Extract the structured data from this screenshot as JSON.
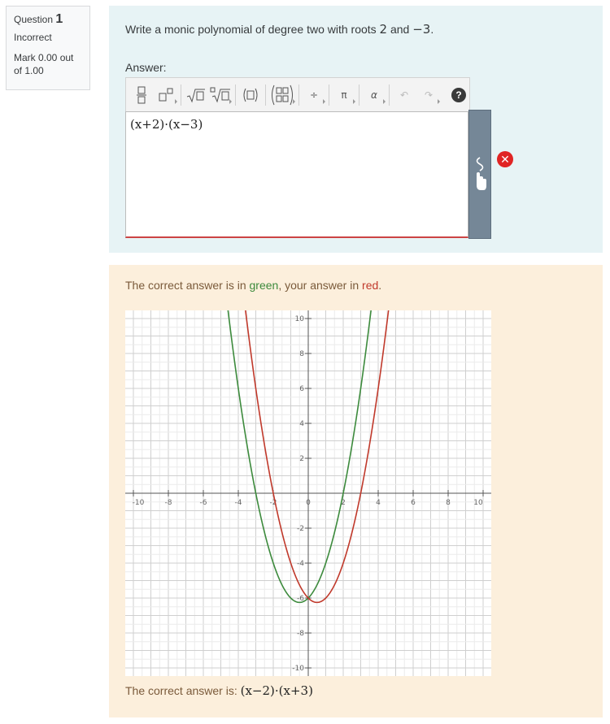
{
  "info": {
    "question_label": "Question",
    "question_number": "1",
    "state": "Incorrect",
    "mark": "Mark 0.00 out of 1.00"
  },
  "question": {
    "text_before": "Write a monic polynomial of degree two with roots ",
    "root1": "2",
    "text_and": " and ",
    "root2": "−3",
    "text_after": "."
  },
  "answer_label": "Answer:",
  "toolbar": {
    "icons": [
      "fraction-icon",
      "superscript-icon",
      "sqrt-icon",
      "nthroot-icon",
      "parentheses-icon",
      "matrix-icon",
      "divide-icon",
      "pi-icon",
      "alpha-icon",
      "undo-icon",
      "redo-icon",
      "help-icon"
    ],
    "help_label": "?"
  },
  "editor": {
    "value": "(x+2)·(x−3)"
  },
  "feedback": {
    "intro_1": "The correct answer is in ",
    "green_word": "green",
    "intro_2": ", your answer in ",
    "red_word": "red",
    "intro_3": ".",
    "correct_prefix": "The correct answer is: ",
    "correct_answer": "(x−2)·(x+3)"
  },
  "colors": {
    "correct": "#3c8a3c",
    "student": "#c0392b",
    "formulation_bg": "#e7f3f5",
    "feedback_bg": "#fcefdc"
  },
  "chart_data": {
    "type": "line",
    "xlim": [
      -10,
      10
    ],
    "ylim": [
      -10,
      10
    ],
    "x_tick_labels": [
      "-10",
      "-8",
      "-6",
      "-4",
      "-2",
      "0",
      "2",
      "4",
      "6",
      "8",
      "10"
    ],
    "y_tick_labels": [
      "10",
      "8",
      "6",
      "4",
      "2",
      "-2",
      "-4",
      "-6",
      "-8",
      "-10"
    ],
    "grid": true,
    "series": [
      {
        "expression": "(x-2)*(x+3)",
        "color": "#3c8a3c",
        "coeffs": [
          1,
          1,
          -6
        ]
      },
      {
        "expression": "(x+2)*(x-3)",
        "color": "#c0392b",
        "coeffs": [
          1,
          -1,
          -6
        ]
      }
    ]
  }
}
